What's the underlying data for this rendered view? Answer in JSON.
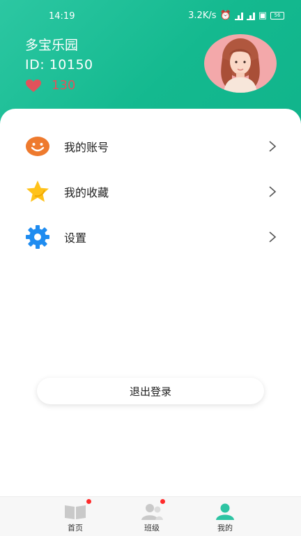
{
  "status_bar": {
    "time": "14:19",
    "network_speed": "3.2K/s",
    "battery": "56"
  },
  "profile": {
    "name": "多宝乐园",
    "id_label": "ID:",
    "id_value": "10150",
    "likes": "130"
  },
  "menu": {
    "items": [
      {
        "label": "我的账号",
        "icon": "smiley-icon"
      },
      {
        "label": "我的收藏",
        "icon": "star-icon"
      },
      {
        "label": "设置",
        "icon": "gear-icon"
      }
    ]
  },
  "logout_label": "退出登录",
  "tabs": [
    {
      "label": "首页",
      "icon": "book-icon",
      "badge": true
    },
    {
      "label": "班级",
      "icon": "people-icon",
      "badge": true
    },
    {
      "label": "我的",
      "icon": "person-icon",
      "active": true
    }
  ],
  "colors": {
    "header": "#14b98f",
    "accent": "#2ec4a3",
    "heart": "#e2525b",
    "badge": "#ff2b2b"
  }
}
